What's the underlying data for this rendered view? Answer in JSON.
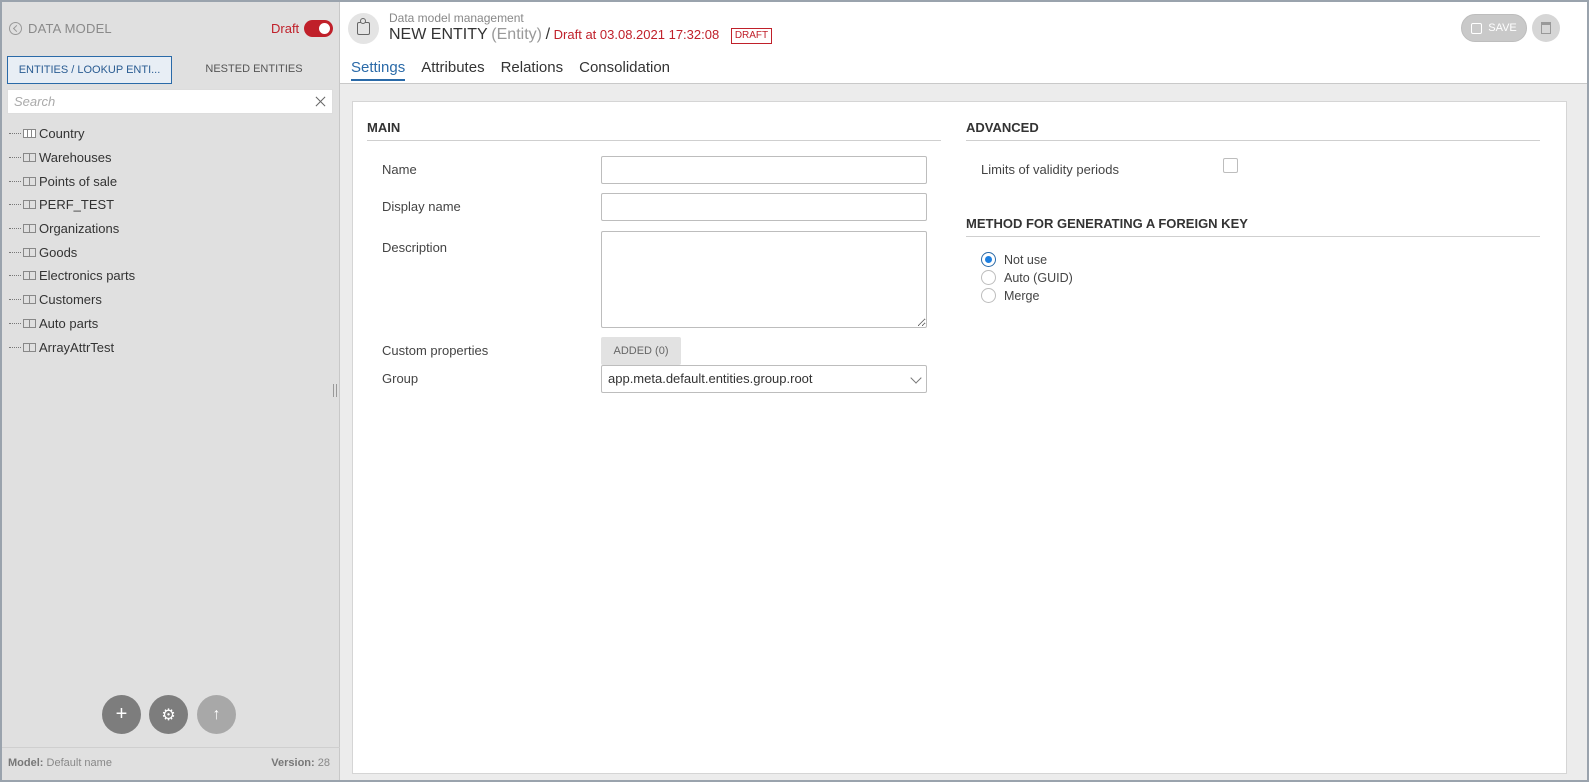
{
  "sidebar": {
    "title": "DATA MODEL",
    "draft_label": "Draft",
    "tabs": [
      {
        "label": "ENTITIES / LOOKUP ENTI..."
      },
      {
        "label": "NESTED ENTITIES"
      }
    ],
    "search_placeholder": "Search",
    "tree": [
      {
        "label": "Country",
        "icon": "table-icon"
      },
      {
        "label": "Warehouses",
        "icon": "book-icon"
      },
      {
        "label": "Points of sale",
        "icon": "book-icon"
      },
      {
        "label": "PERF_TEST",
        "icon": "book-icon"
      },
      {
        "label": "Organizations",
        "icon": "book-icon"
      },
      {
        "label": "Goods",
        "icon": "book-icon"
      },
      {
        "label": "Electronics parts",
        "icon": "book-icon"
      },
      {
        "label": "Customers",
        "icon": "book-icon"
      },
      {
        "label": "Auto parts",
        "icon": "book-icon"
      },
      {
        "label": "ArrayAttrTest",
        "icon": "book-icon"
      }
    ],
    "footer": {
      "model_key": "Model:",
      "model_value": "Default name",
      "version_key": "Version:",
      "version_value": "28"
    }
  },
  "header": {
    "breadcrumb": "Data model management",
    "entity_name": "NEW ENTITY",
    "entity_kind": "(Entity)",
    "separator": "/",
    "draft_info": "Draft at 03.08.2021 17:32:08",
    "badge": "DRAFT",
    "save_label": "SAVE",
    "tabs": [
      {
        "label": "Settings"
      },
      {
        "label": "Attributes"
      },
      {
        "label": "Relations"
      },
      {
        "label": "Consolidation"
      }
    ]
  },
  "main": {
    "section_title": "MAIN",
    "name_label": "Name",
    "name_value": "",
    "display_name_label": "Display name",
    "display_name_value": "",
    "description_label": "Description",
    "description_value": "",
    "custom_properties_label": "Custom properties",
    "custom_properties_button": "ADDED (0)",
    "group_label": "Group",
    "group_value": "app.meta.default.entities.group.root"
  },
  "advanced": {
    "section_title": "ADVANCED",
    "limits_label": "Limits of validity periods",
    "limits_checked": false
  },
  "foreign_key": {
    "section_title": "METHOD FOR GENERATING A FOREIGN KEY",
    "options": [
      {
        "label": "Not use",
        "checked": true
      },
      {
        "label": "Auto (GUID)",
        "checked": false
      },
      {
        "label": "Merge",
        "checked": false
      }
    ]
  },
  "colors": {
    "accent": "#2a6aa8",
    "draft_red": "#c0202a",
    "radio_blue": "#1e7fe0"
  }
}
